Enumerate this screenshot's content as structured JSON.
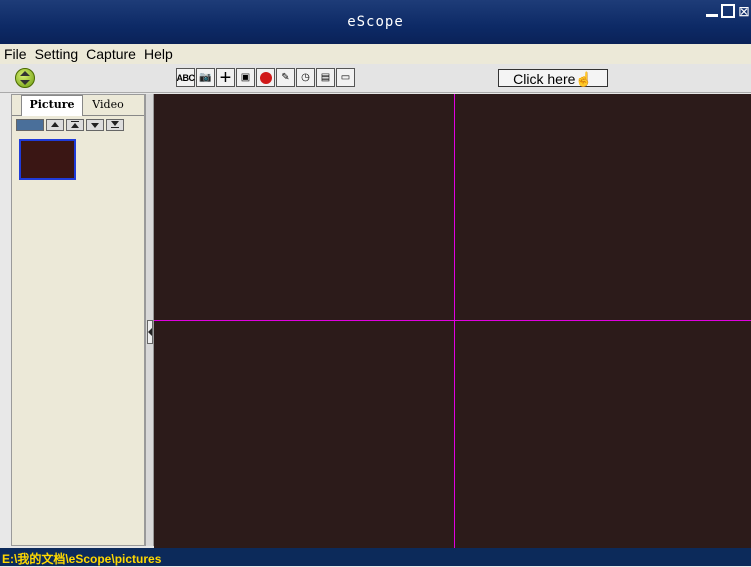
{
  "window": {
    "title": "eScope"
  },
  "menu": {
    "items": [
      "File",
      "Setting",
      "Capture",
      "Help"
    ]
  },
  "toolbar": {
    "abc_label": "ABC",
    "click_here_label": "Click here",
    "tools": [
      "text-tool-icon",
      "camera-icon",
      "crosshair-icon",
      "snapshot-icon",
      "record-icon",
      "paint-icon",
      "timer-icon",
      "gallery-icon",
      "save-icon"
    ]
  },
  "panel": {
    "tabs": [
      "Picture",
      "Video"
    ],
    "selected_tab": "Picture"
  },
  "crosshair_color": "#e000e0",
  "status": {
    "path": "E:\\我的文档\\eScope\\pictures"
  }
}
